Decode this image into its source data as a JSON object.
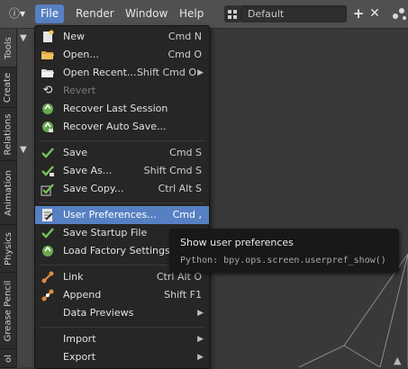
{
  "header": {
    "menus": [
      "File",
      "Render",
      "Window",
      "Help"
    ],
    "active_menu": "File",
    "screen_layout": "Default",
    "add_icon": "plus-icon",
    "close_icon": "close-icon"
  },
  "tool_tabs": [
    "Tools",
    "Create",
    "Relations",
    "Animation",
    "Physics",
    "Grease Pencil",
    "ol"
  ],
  "file_menu": {
    "items": [
      {
        "label": "New",
        "shortcut": "Cmd N",
        "icon": "new-file-icon"
      },
      {
        "label": "Open...",
        "shortcut": "Cmd O",
        "icon": "open-folder-icon"
      },
      {
        "label": "Open Recent...",
        "shortcut": "Shift Cmd O",
        "icon": "open-recent-icon",
        "submenu": true
      },
      {
        "label": "Revert",
        "shortcut": "",
        "icon": "revert-icon",
        "disabled": true
      },
      {
        "label": "Recover Last Session",
        "shortcut": "",
        "icon": "recover-icon"
      },
      {
        "label": "Recover Auto Save...",
        "shortcut": "",
        "icon": "recover-auto-icon"
      },
      {
        "label": "Save",
        "shortcut": "Cmd S",
        "icon": "checkmark-icon"
      },
      {
        "label": "Save As...",
        "shortcut": "Shift Cmd S",
        "icon": "save-as-icon"
      },
      {
        "label": "Save Copy...",
        "shortcut": "Ctrl Alt S",
        "icon": "save-copy-icon"
      },
      {
        "label": "User Preferences...",
        "shortcut": "Cmd ,",
        "icon": "preferences-icon",
        "highlighted": true
      },
      {
        "label": "Save Startup File",
        "shortcut": "",
        "icon": "save-startup-icon"
      },
      {
        "label": "Load Factory Settings",
        "shortcut": "",
        "icon": "load-factory-icon"
      },
      {
        "label": "Link",
        "shortcut": "Ctrl Alt O",
        "icon": "link-icon"
      },
      {
        "label": "Append",
        "shortcut": "Shift F1",
        "icon": "append-icon"
      },
      {
        "label": "Data Previews",
        "shortcut": "",
        "icon": "",
        "submenu": true
      },
      {
        "label": "Import",
        "shortcut": "",
        "icon": "",
        "submenu": true
      },
      {
        "label": "Export",
        "shortcut": "",
        "icon": "",
        "submenu": true
      }
    ]
  },
  "tooltip": {
    "title": "Show user preferences",
    "python": "Python: bpy.ops.screen.userpref_show()"
  }
}
